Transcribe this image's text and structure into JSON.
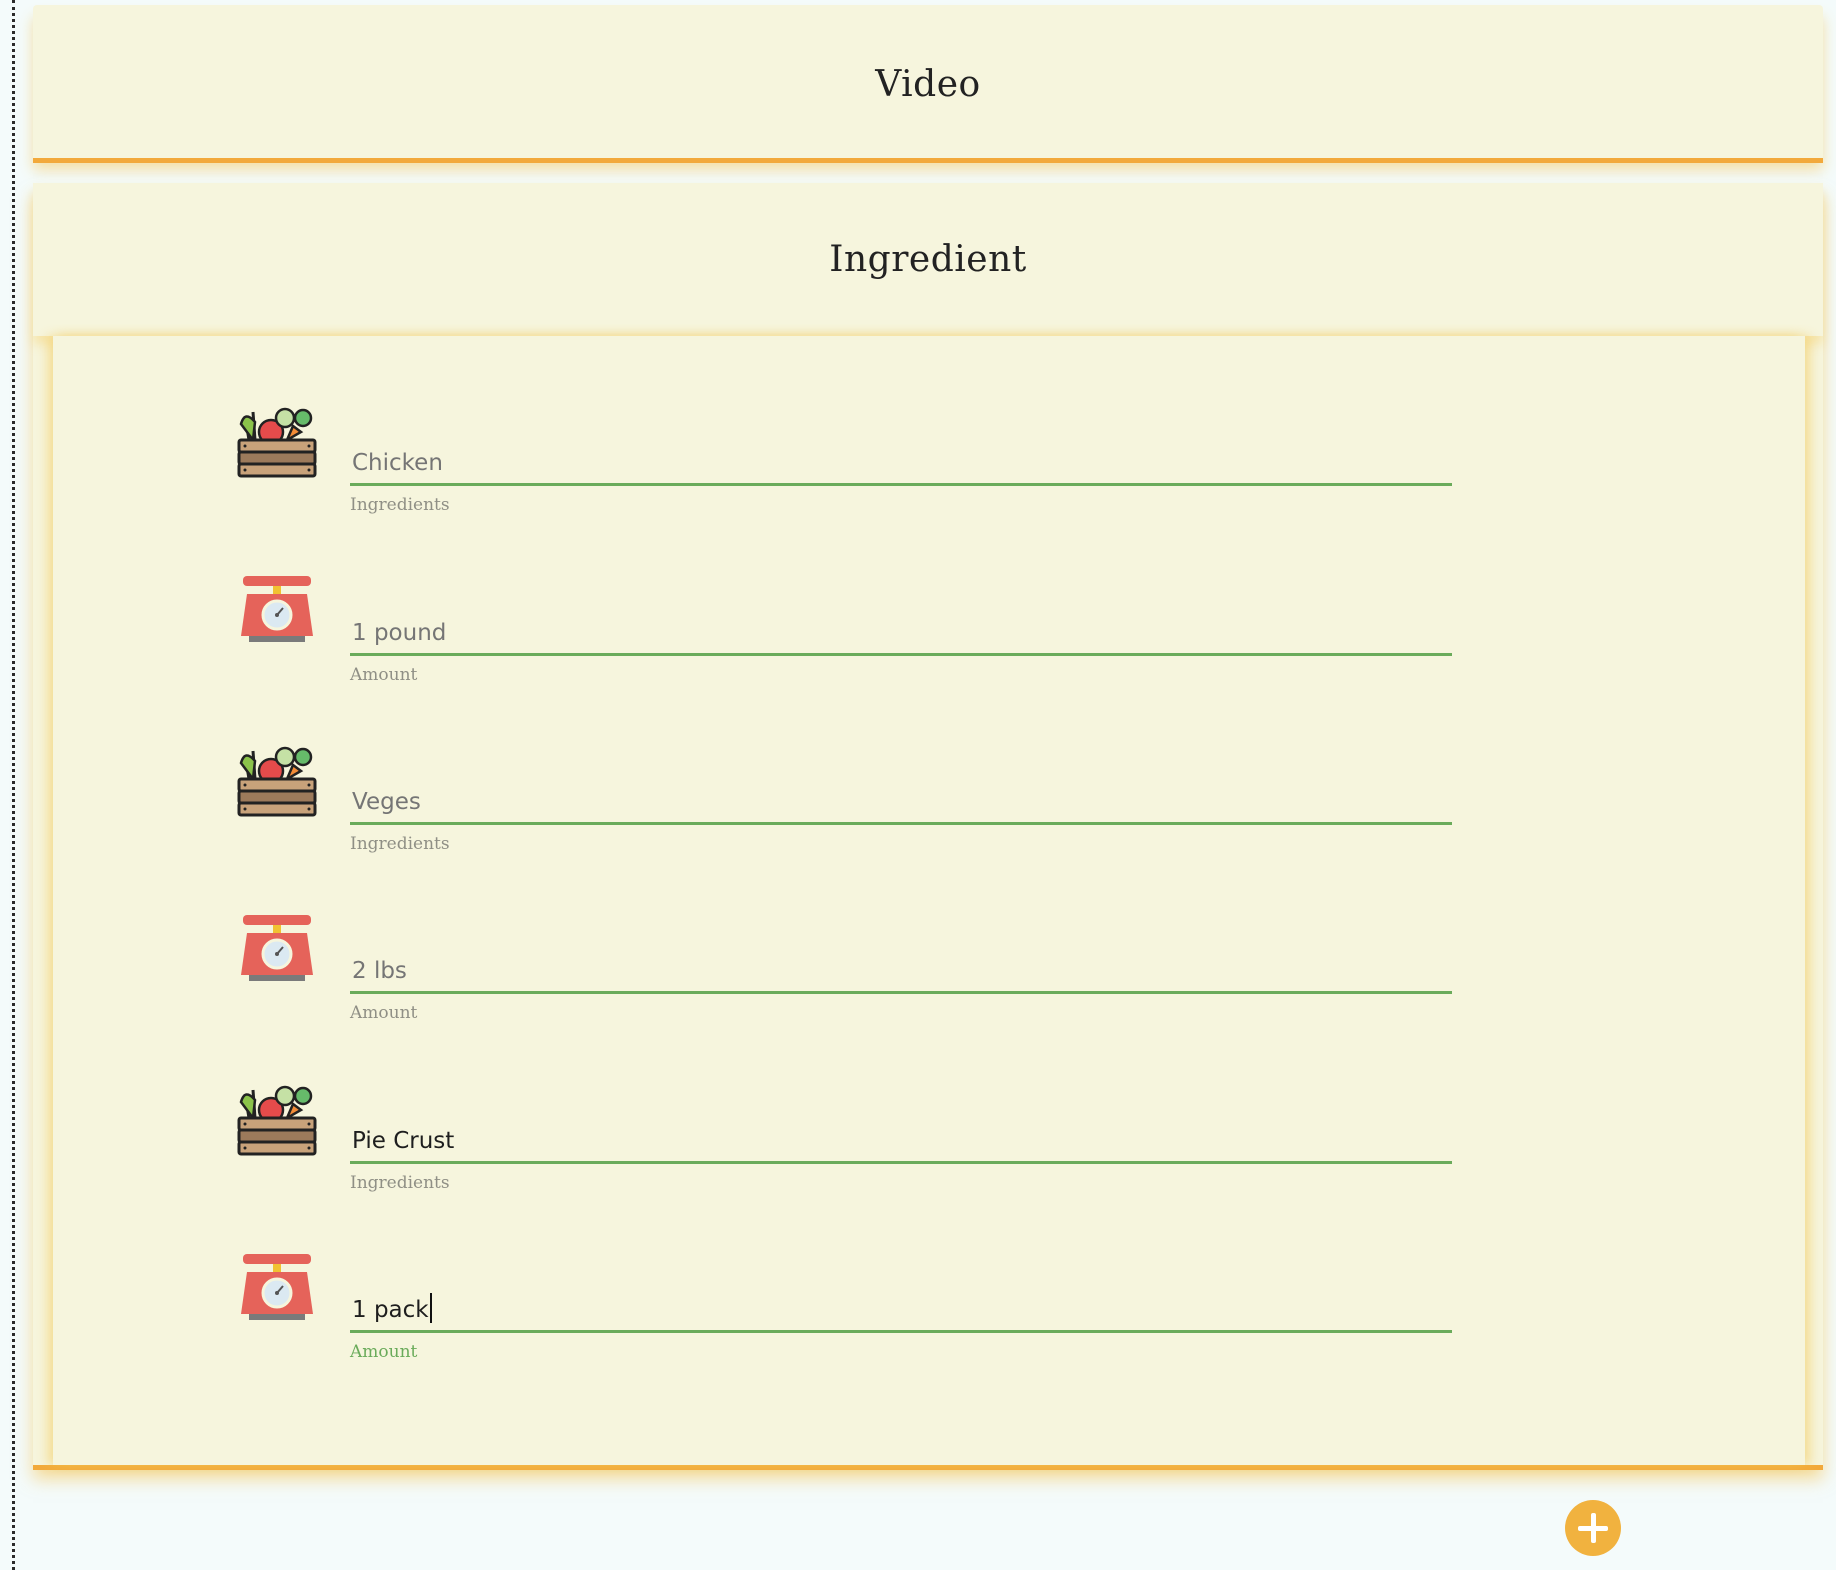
{
  "video_section": {
    "title": "Video"
  },
  "ingredient_section": {
    "title": "Ingredient",
    "rows": [
      {
        "icon": "vegetable-crate-icon",
        "value": "Chicken",
        "label": "Ingredients",
        "filled": false
      },
      {
        "icon": "kitchen-scale-icon",
        "value": "1 pound",
        "label": "Amount",
        "filled": false
      },
      {
        "icon": "vegetable-crate-icon",
        "value": "Veges",
        "label": "Ingredients",
        "filled": false
      },
      {
        "icon": "kitchen-scale-icon",
        "value": "2 lbs",
        "label": "Amount",
        "filled": false
      },
      {
        "icon": "vegetable-crate-icon",
        "value": "Pie Crust",
        "label": "Ingredients",
        "filled": true
      },
      {
        "icon": "kitchen-scale-icon",
        "value": "1 pack",
        "label": "Amount",
        "filled": true,
        "focused": true
      }
    ]
  },
  "add_button": {
    "icon": "plus-icon"
  },
  "colors": {
    "panel_bg": "#f6f5dd",
    "accent_orange": "#f2a93b",
    "underline_green": "#6aab5a",
    "add_button": "#f1b23f"
  }
}
